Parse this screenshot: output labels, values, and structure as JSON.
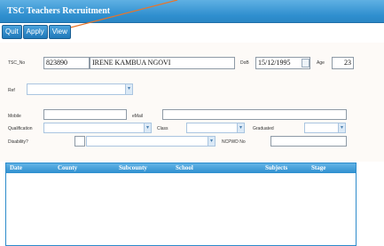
{
  "window": {
    "title": "TSC Teachers Recruitment"
  },
  "toolbar": {
    "quit": "Quit",
    "apply": "Apply",
    "view": "View"
  },
  "form": {
    "tsc_no_label": "TSC_No",
    "tsc_no_value": "823890",
    "name_value": "IRENE KAMBUA NGOVI",
    "dob_label": "DoB",
    "dob_value": "15/12/1995",
    "age_label": "Age",
    "age_value": "23",
    "ref_label": "Ref",
    "mobile_label": "Mobile",
    "email_label": "eMail",
    "qualification_label": "Qualification",
    "class_label": "Class",
    "graduated_label": "Graduated",
    "disability_label": "Disability?",
    "ncpwd_label": "NCPWD No"
  },
  "grid": {
    "columns": [
      "Date",
      "County",
      "Subcounty",
      "School",
      "Subjects",
      "Stage"
    ]
  },
  "colors": {
    "titlebar": "#2f8fcf",
    "accent_line": "#e8752a"
  }
}
